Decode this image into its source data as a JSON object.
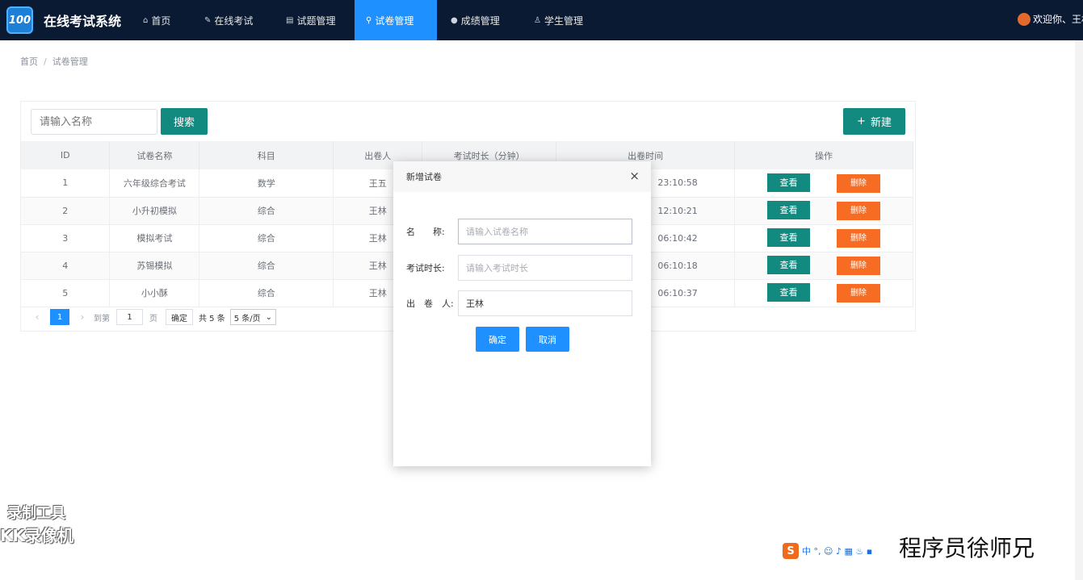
{
  "app": {
    "logo_text": "100",
    "title": "在线考试系统"
  },
  "nav": [
    {
      "label": "首页",
      "icon": "home-icon",
      "glyph": "⌂",
      "active": false
    },
    {
      "label": "在线考试",
      "icon": "edit-icon",
      "glyph": "✎",
      "active": false
    },
    {
      "label": "试题管理",
      "icon": "document-icon",
      "glyph": "▤",
      "active": false
    },
    {
      "label": "试卷管理",
      "icon": "link-icon",
      "glyph": "⚲",
      "active": true
    },
    {
      "label": "成绩管理",
      "icon": "chart-icon",
      "glyph": "●",
      "active": false
    },
    {
      "label": "学生管理",
      "icon": "user-icon",
      "glyph": "♙",
      "active": false
    }
  ],
  "user": {
    "welcome": "欢迎你、王林"
  },
  "breadcrumb": {
    "home": "首页",
    "current": "试卷管理",
    "separator": "/"
  },
  "toolbar": {
    "search_placeholder": "请输入名称",
    "search_label": "搜索",
    "new_label": "新建",
    "new_icon": "+"
  },
  "table": {
    "columns": [
      "ID",
      "试卷名称",
      "科目",
      "出卷人",
      "考试时长（分钟）",
      "出卷时间",
      "操作"
    ],
    "rows": [
      {
        "id": "1",
        "name": "六年级综合考试",
        "subject": "数学",
        "author": "王五",
        "time": "23:10:58"
      },
      {
        "id": "2",
        "name": "小升初模拟",
        "subject": "综合",
        "author": "王林",
        "time": "12:10:21"
      },
      {
        "id": "3",
        "name": "模拟考试",
        "subject": "综合",
        "author": "王林",
        "time": "06:10:42"
      },
      {
        "id": "4",
        "name": "苏锡模拟",
        "subject": "综合",
        "author": "王林",
        "time": "06:10:18"
      },
      {
        "id": "5",
        "name": "小小酥",
        "subject": "综合",
        "author": "王林",
        "time": "06:10:37"
      }
    ],
    "view_label": "查看",
    "delete_label": "删除"
  },
  "pager": {
    "prev": "‹",
    "next": "›",
    "current_page": "1",
    "goto_label": "到第",
    "goto_value": "1",
    "page_unit": "页",
    "confirm_label": "确定",
    "total_label": "共 5 条",
    "page_size": "5 条/页"
  },
  "modal": {
    "title": "新增试卷",
    "close": "×",
    "name_label": "名　　称:",
    "name_placeholder": "请输入试卷名称",
    "duration_label": "考试时长:",
    "duration_placeholder": "请输入考试时长",
    "author_label": "出　卷　人:",
    "author_value": "王林",
    "ok_label": "确定",
    "cancel_label": "取消"
  },
  "overlay": {
    "recorder_line1": "录制工具",
    "recorder_line2": "KK录像机",
    "ime_logo": "S",
    "ime_text": "中 °, ☺ ♪ ▦ ♨ ▪",
    "author_signature": "程序员徐师兄"
  }
}
